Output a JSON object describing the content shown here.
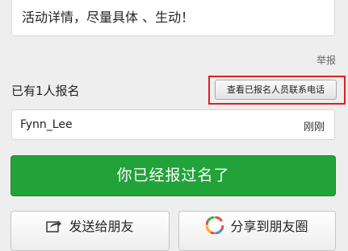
{
  "activity": {
    "description_text": "活动详情，尽量具体 、生动！",
    "report_label": "举报"
  },
  "signup": {
    "count_label": "已有1人报名",
    "view_contacts_button": "查看已报名人员联系电话",
    "entries": [
      {
        "name": "Fynn_Lee",
        "time": "刚刚"
      }
    ]
  },
  "status_button_label": "你已经报过名了",
  "share": {
    "send_friend_label": "发送给朋友",
    "moments_label": "分享到朋友圈"
  },
  "colors": {
    "primary_green": "#22a33a",
    "highlight_red": "#e02020",
    "background": "#eeeeee"
  },
  "icons": {
    "send_friend": "share-arrow-icon",
    "moments": "moments-aperture-icon"
  }
}
